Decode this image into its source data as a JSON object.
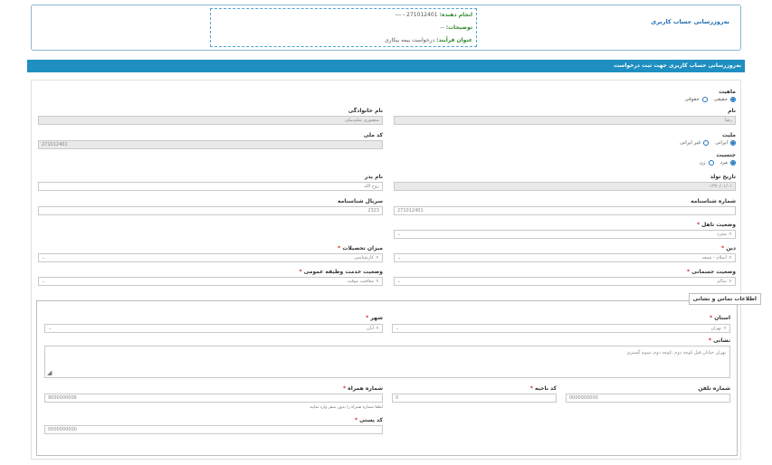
{
  "header": {
    "title": "به‌روزرسانی حساب کاربری",
    "info": {
      "doer_label": "انجام دهنده:",
      "doer_value": "271012401 - ---",
      "desc_label": "توضیحات:",
      "desc_value": "--",
      "process_label": "عنوان فرآیند:",
      "process_value": "درخواست بیمه بیکاری"
    }
  },
  "section_bar": "به‌روزرسانی حساب کاربری جهت ثبت درخواست",
  "form": {
    "nature": {
      "label": "ماهیت",
      "options": [
        "حقیقی",
        "حقوقی"
      ]
    },
    "first_name": {
      "label": "نام",
      "value": "رضا"
    },
    "last_name": {
      "label": "نام خانوادگی",
      "value": "منصوری شلم‌نیکی"
    },
    "national_code": {
      "label": "کد ملی",
      "value": "271012401"
    },
    "nationality": {
      "label": "ملیت",
      "options": [
        "ایرانی",
        "غیر ایرانی"
      ]
    },
    "gender": {
      "label": "جنسیت",
      "options": [
        "مرد",
        "زن"
      ]
    },
    "birth_date": {
      "label": "تاریخ تولد",
      "value": "۱۳۷۰/۰۱/۰۱"
    },
    "father_name": {
      "label": "نام پدر",
      "value": "روح الله"
    },
    "id_number": {
      "label": "شماره شناسنامه",
      "value": "271012401"
    },
    "id_serial": {
      "label": "سریال شناسنامه",
      "value": "2323"
    },
    "marital": {
      "label": "وضعیت تاهل",
      "value": "مجرد"
    },
    "religion": {
      "label": "دین",
      "value": "اسلام - شیعه"
    },
    "education": {
      "label": "میزان تحصیلات",
      "value": "کارشناسی"
    },
    "physical": {
      "label": "وضعیت جسمانی",
      "value": "سالم"
    },
    "military": {
      "label": "وضعیت خدمت وظیفه عمومی",
      "value": "معافیت موقت"
    }
  },
  "contact": {
    "legend": "اطلاعات تماس و نشانی",
    "province": {
      "label": "استان",
      "value": "تهران"
    },
    "city": {
      "label": "شهر",
      "value": "آبان"
    },
    "address": {
      "label": "نشانی",
      "value": "تهران خیابان قبل کوچه دوم ،کوچه دوم ،سوم گستری"
    },
    "phone": {
      "label": "شماره تلفن",
      "value": "0000000000"
    },
    "area_code": {
      "label": "کد ناحیه",
      "value": "0"
    },
    "mobile": {
      "label": "شماره همراه",
      "value": "9000000006",
      "hint": "لطفا شماره همراه را بدون صفر وارد نمایید"
    },
    "postal": {
      "label": "کد پستی",
      "value": "0000000000"
    }
  },
  "colors": {
    "accent": "#1e8fc0",
    "required": "#d32f2f",
    "header_title": "#1f6fb2",
    "info_key": "#2f8a2f"
  },
  "icons": {
    "select_arrow": "chevron-down-icon",
    "resize": "resize-handle-icon"
  }
}
